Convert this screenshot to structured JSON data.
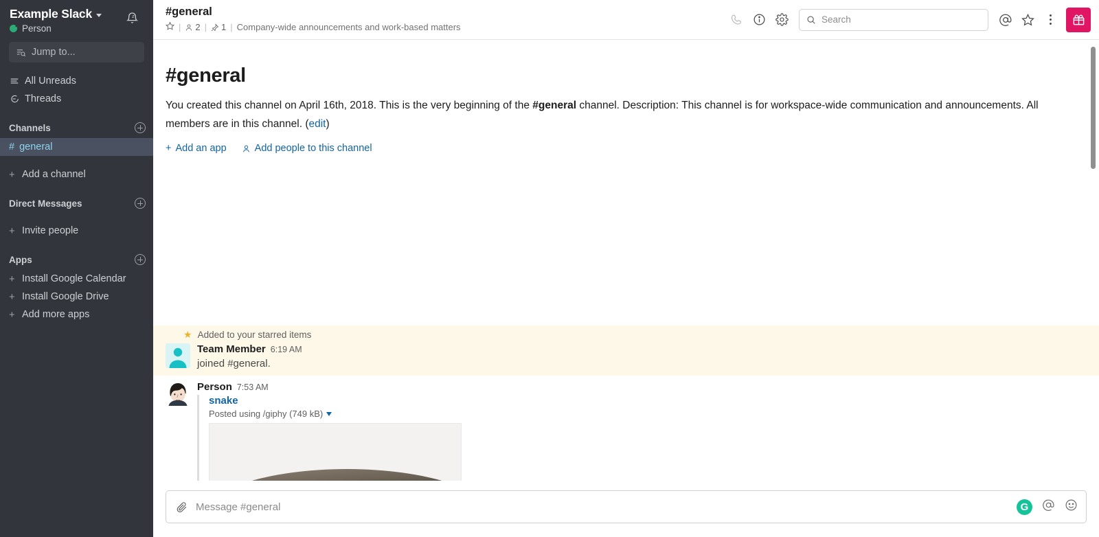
{
  "sidebar": {
    "workspace_name": "Example Slack",
    "user_name": "Person",
    "presence_status": "away",
    "jump_to_placeholder": "Jump to...",
    "nav": [
      {
        "label": "All Unreads",
        "icon": "unreads-icon"
      },
      {
        "label": "Threads",
        "icon": "threads-icon"
      }
    ],
    "sections": [
      {
        "title": "Channels",
        "items": [
          {
            "label": "general",
            "prefix": "#",
            "active": true
          }
        ],
        "add_label": "Add a channel"
      },
      {
        "title": "Direct Messages",
        "items": [],
        "add_label": "Invite people"
      },
      {
        "title": "Apps",
        "items": [],
        "app_links": [
          "Install Google Calendar",
          "Install Google Drive",
          "Add more apps"
        ]
      }
    ]
  },
  "topbar": {
    "channel_title": "#general",
    "member_count": "2",
    "pin_count": "1",
    "topic": "Company-wide announcements and work-based matters",
    "search_placeholder": "Search",
    "icons": [
      "phone-icon",
      "info-icon",
      "gear-icon",
      "mention-icon",
      "star-icon",
      "kebab-menu-icon",
      "gift-icon"
    ],
    "gift_button_color": "#e01563"
  },
  "intro": {
    "title": "#general",
    "text_1": "You created this channel on April 16th, 2018. This is the very beginning of the ",
    "channel_bold": "#general",
    "text_2": " channel. Description: This channel is for workspace-wide communication and announcements. All members are in this channel. (",
    "edit_link": "edit",
    "text_3": ")",
    "add_app_label": "Add an app",
    "add_people_label": "Add people to this channel"
  },
  "starred_banner": {
    "label": "Added to your starred items"
  },
  "messages": [
    {
      "author": "Team Member",
      "time": "6:19 AM",
      "text": "joined #general.",
      "avatar": "default-person-avatar",
      "starred": true
    },
    {
      "author": "Person",
      "time": "7:53 AM",
      "avatar": "person-photo-avatar",
      "attachment": {
        "title": "snake",
        "subtitle": "Posted using /giphy (749 kB)",
        "image_alt": "snake-gif-preview"
      }
    }
  ],
  "composer": {
    "placeholder": "Message #general",
    "attach_icon": "paperclip-icon",
    "grammarly_icon": "G",
    "mention_icon": "mention-icon",
    "emoji_icon": "emoji-icon"
  },
  "colors": {
    "sidebar_bg": "#32353b",
    "active_channel_bg": "#4a5160",
    "active_channel_text": "#8ed3ec",
    "link_blue": "#1264a3",
    "starred_bg": "#fdf8e8",
    "accent_pink": "#e01563",
    "grammarly_green": "#15c39a"
  }
}
